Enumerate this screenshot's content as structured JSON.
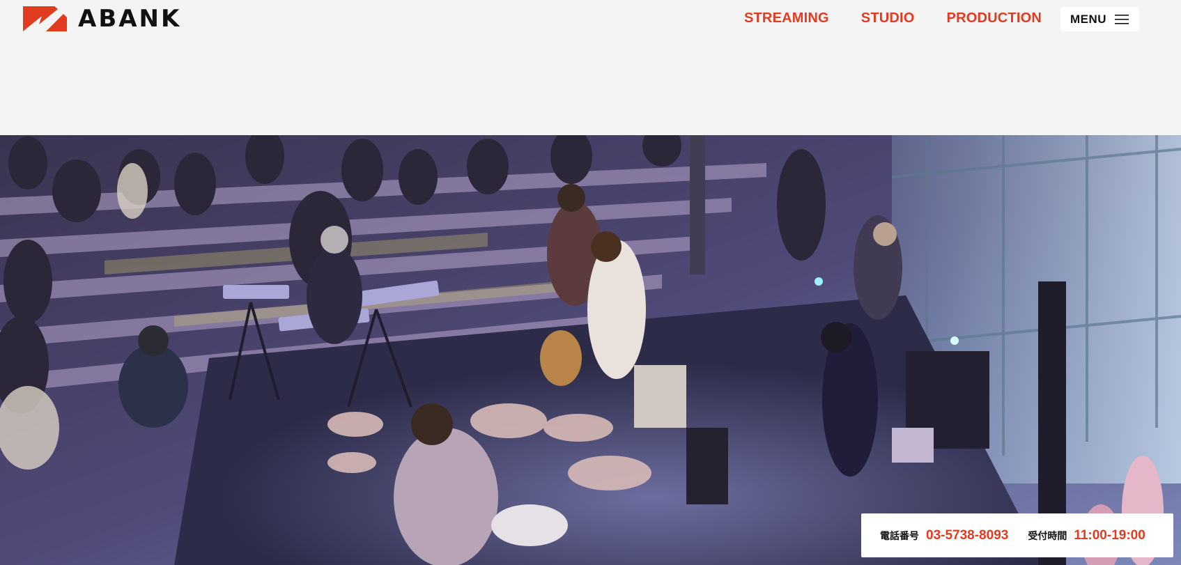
{
  "brand": {
    "name": "ABANK",
    "color": "#e33b1f"
  },
  "nav": {
    "items": [
      {
        "label": "STREAMING"
      },
      {
        "label": "STUDIO"
      },
      {
        "label": "PRODUCTION"
      }
    ],
    "menu_label": "MENU",
    "menu_icon": "hamburger-icon"
  },
  "hero": {
    "image": "concert-photo",
    "description_icon": "live-band-performance"
  },
  "contact": {
    "phone_label": "電話番号",
    "phone": "03-5738-8093",
    "hours_label": "受付時間",
    "hours": "11:00-19:00"
  }
}
